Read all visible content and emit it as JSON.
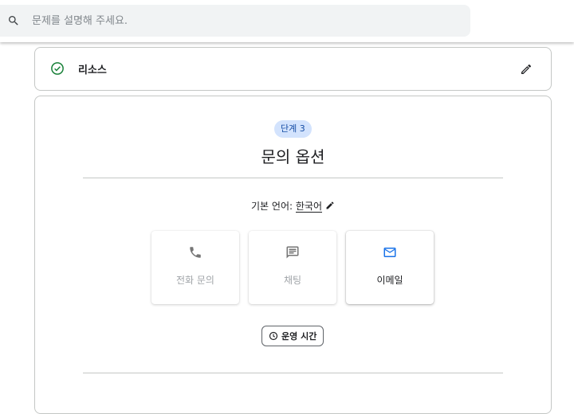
{
  "search": {
    "placeholder": "문제를 설명해 주세요.",
    "value": ""
  },
  "completed_step": {
    "title": "리소스",
    "status_color": "#188038"
  },
  "current_step": {
    "badge": "단계 3",
    "title": "문의 옵션",
    "language_label": "기본 언어: ",
    "language_value": "한국어",
    "options": [
      {
        "label": "전화 문의",
        "icon": "phone-icon",
        "enabled": false
      },
      {
        "label": "채팅",
        "icon": "chat-icon",
        "enabled": false
      },
      {
        "label": "이메일",
        "icon": "mail-icon",
        "enabled": true
      }
    ],
    "hours_button": "운영 시간"
  },
  "colors": {
    "accent_blue": "#1a73e8",
    "badge_bg": "#d3e3fd",
    "disabled_icon": "#757575"
  }
}
